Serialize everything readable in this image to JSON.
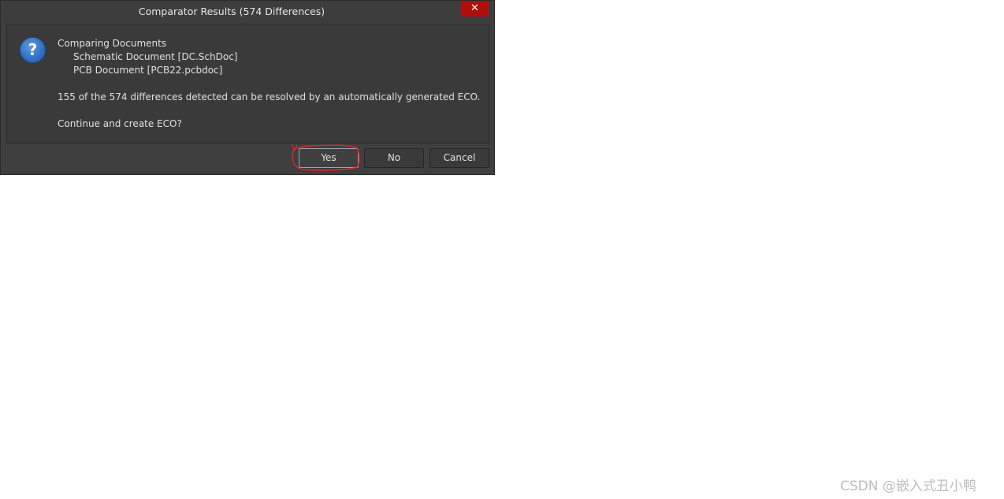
{
  "dialog": {
    "title": "Comparator Results (574 Differences)",
    "close_symbol": "✕",
    "icon": "help-question-icon",
    "icon_glyph": "?",
    "message": {
      "heading": "Comparing Documents",
      "doc1": "Schematic Document [DC.SchDoc]",
      "doc2": "PCB Document [PCB22.pcbdoc]",
      "summary": "155 of the 574 differences detected can be resolved by an automatically generated ECO.",
      "question": "Continue and create ECO?"
    },
    "buttons": {
      "yes": "Yes",
      "no": "No",
      "cancel": "Cancel"
    }
  },
  "watermark": "CSDN @嵌入式丑小鸭",
  "colors": {
    "dialog_bg": "#3f3f3f",
    "close_button": "#b00d0d",
    "help_icon": "#2f6fc4",
    "annotation": "#e0262b"
  }
}
